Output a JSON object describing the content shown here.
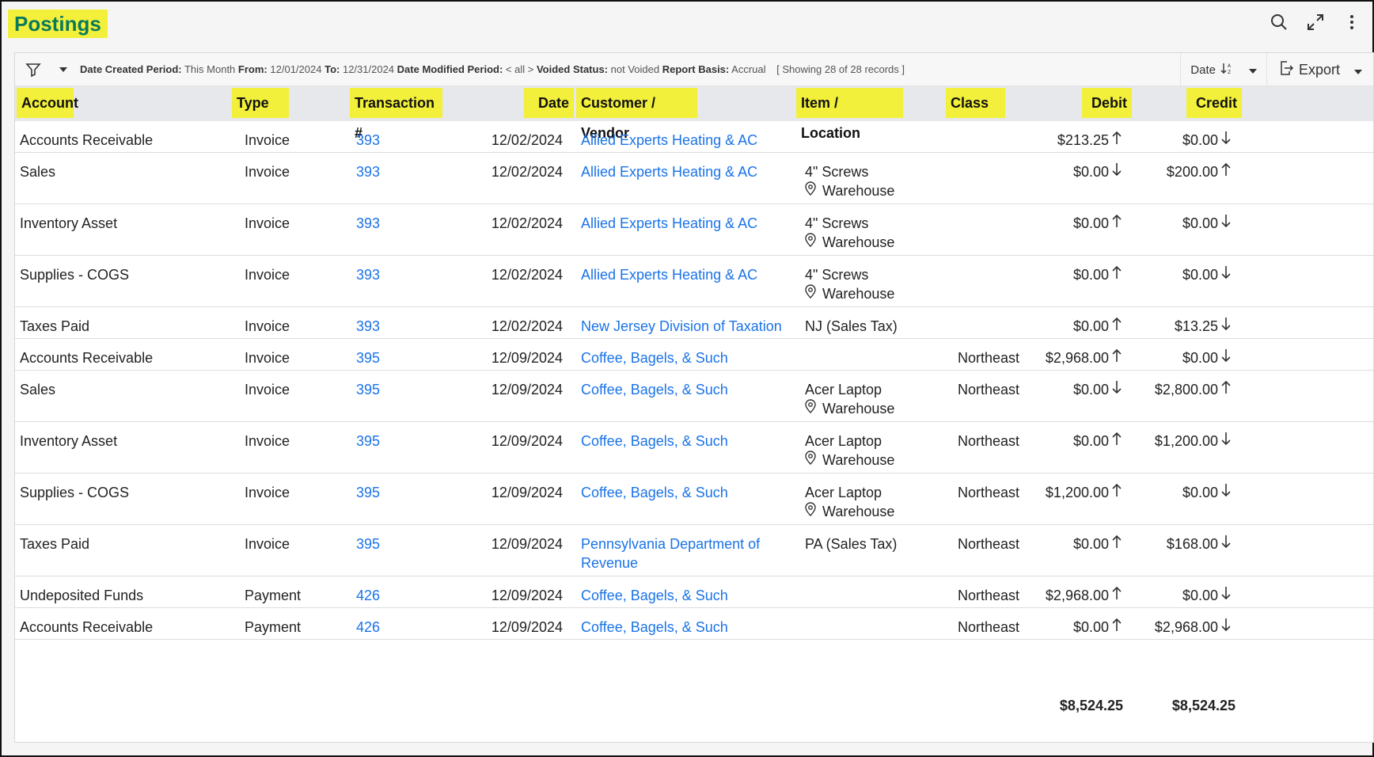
{
  "page": {
    "title": "Postings"
  },
  "toolbar": {
    "filters": [
      {
        "label": "Date Created Period:",
        "value": "This Month"
      },
      {
        "label": "From:",
        "value": "12/01/2024"
      },
      {
        "label": "To:",
        "value": "12/31/2024"
      },
      {
        "label": "Date Modified Period:",
        "value": "< all >"
      },
      {
        "label": "Voided Status:",
        "value": "not Voided"
      },
      {
        "label": "Report Basis:",
        "value": "Accrual"
      }
    ],
    "showing": "[ Showing 28 of 28 records ]",
    "sort_label": "Date",
    "export_label": "Export"
  },
  "columns": [
    "Account",
    "Type",
    "Transaction #",
    "Date",
    "Customer / Vendor",
    "Item / Location",
    "Class",
    "Debit",
    "Credit"
  ],
  "rows": [
    {
      "account": "Accounts Receivable",
      "type": "Invoice",
      "txn": "393",
      "date": "12/02/2024",
      "vendor": "Allied Experts Heating & AC",
      "vendor2": "",
      "item": "",
      "location": "",
      "class": "",
      "debit": "$213.25",
      "debit_dir": "up",
      "credit": "$0.00",
      "credit_dir": "down"
    },
    {
      "account": "Sales",
      "type": "Invoice",
      "txn": "393",
      "date": "12/02/2024",
      "vendor": "Allied Experts Heating & AC",
      "vendor2": "",
      "item": "4\" Screws",
      "location": "Warehouse",
      "class": "",
      "debit": "$0.00",
      "debit_dir": "down",
      "credit": "$200.00",
      "credit_dir": "up"
    },
    {
      "account": "Inventory Asset",
      "type": "Invoice",
      "txn": "393",
      "date": "12/02/2024",
      "vendor": "Allied Experts Heating & AC",
      "vendor2": "",
      "item": "4\" Screws",
      "location": "Warehouse",
      "class": "",
      "debit": "$0.00",
      "debit_dir": "up",
      "credit": "$0.00",
      "credit_dir": "down"
    },
    {
      "account": "Supplies - COGS",
      "type": "Invoice",
      "txn": "393",
      "date": "12/02/2024",
      "vendor": "Allied Experts Heating & AC",
      "vendor2": "",
      "item": "4\" Screws",
      "location": "Warehouse",
      "class": "",
      "debit": "$0.00",
      "debit_dir": "up",
      "credit": "$0.00",
      "credit_dir": "down"
    },
    {
      "account": "Taxes Paid",
      "type": "Invoice",
      "txn": "393",
      "date": "12/02/2024",
      "vendor": "New Jersey Division of Taxation",
      "vendor2": "",
      "item": "NJ (Sales Tax)",
      "location": "",
      "class": "",
      "debit": "$0.00",
      "debit_dir": "up",
      "credit": "$13.25",
      "credit_dir": "down"
    },
    {
      "account": "Accounts Receivable",
      "type": "Invoice",
      "txn": "395",
      "date": "12/09/2024",
      "vendor": "Coffee, Bagels, & Such",
      "vendor2": "",
      "item": "",
      "location": "",
      "class": "Northeast",
      "debit": "$2,968.00",
      "debit_dir": "up",
      "credit": "$0.00",
      "credit_dir": "down"
    },
    {
      "account": "Sales",
      "type": "Invoice",
      "txn": "395",
      "date": "12/09/2024",
      "vendor": "Coffee, Bagels, & Such",
      "vendor2": "",
      "item": "Acer Laptop",
      "location": "Warehouse",
      "class": "Northeast",
      "debit": "$0.00",
      "debit_dir": "down",
      "credit": "$2,800.00",
      "credit_dir": "up"
    },
    {
      "account": "Inventory Asset",
      "type": "Invoice",
      "txn": "395",
      "date": "12/09/2024",
      "vendor": "Coffee, Bagels, & Such",
      "vendor2": "",
      "item": "Acer Laptop",
      "location": "Warehouse",
      "class": "Northeast",
      "debit": "$0.00",
      "debit_dir": "up",
      "credit": "$1,200.00",
      "credit_dir": "down"
    },
    {
      "account": "Supplies - COGS",
      "type": "Invoice",
      "txn": "395",
      "date": "12/09/2024",
      "vendor": "Coffee, Bagels, & Such",
      "vendor2": "",
      "item": "Acer Laptop",
      "location": "Warehouse",
      "class": "Northeast",
      "debit": "$1,200.00",
      "debit_dir": "up",
      "credit": "$0.00",
      "credit_dir": "down"
    },
    {
      "account": "Taxes Paid",
      "type": "Invoice",
      "txn": "395",
      "date": "12/09/2024",
      "vendor": "Pennsylvania Department of",
      "vendor2": "Revenue",
      "item": "PA (Sales Tax)",
      "location": "",
      "class": "Northeast",
      "debit": "$0.00",
      "debit_dir": "up",
      "credit": "$168.00",
      "credit_dir": "down"
    },
    {
      "account": "Undeposited Funds",
      "type": "Payment",
      "txn": "426",
      "date": "12/09/2024",
      "vendor": "Coffee, Bagels, & Such",
      "vendor2": "",
      "item": "",
      "location": "",
      "class": "Northeast",
      "debit": "$2,968.00",
      "debit_dir": "up",
      "credit": "$0.00",
      "credit_dir": "down"
    },
    {
      "account": "Accounts Receivable",
      "type": "Payment",
      "txn": "426",
      "date": "12/09/2024",
      "vendor": "Coffee, Bagels, & Such",
      "vendor2": "",
      "item": "",
      "location": "",
      "class": "Northeast",
      "debit": "$0.00",
      "debit_dir": "up",
      "credit": "$2,968.00",
      "credit_dir": "down"
    }
  ],
  "totals": {
    "debit": "$8,524.25",
    "credit": "$8,524.25"
  },
  "colors": {
    "highlight": "#f2f03a",
    "title_text": "#0a7a5a",
    "link": "#1a73e8"
  }
}
